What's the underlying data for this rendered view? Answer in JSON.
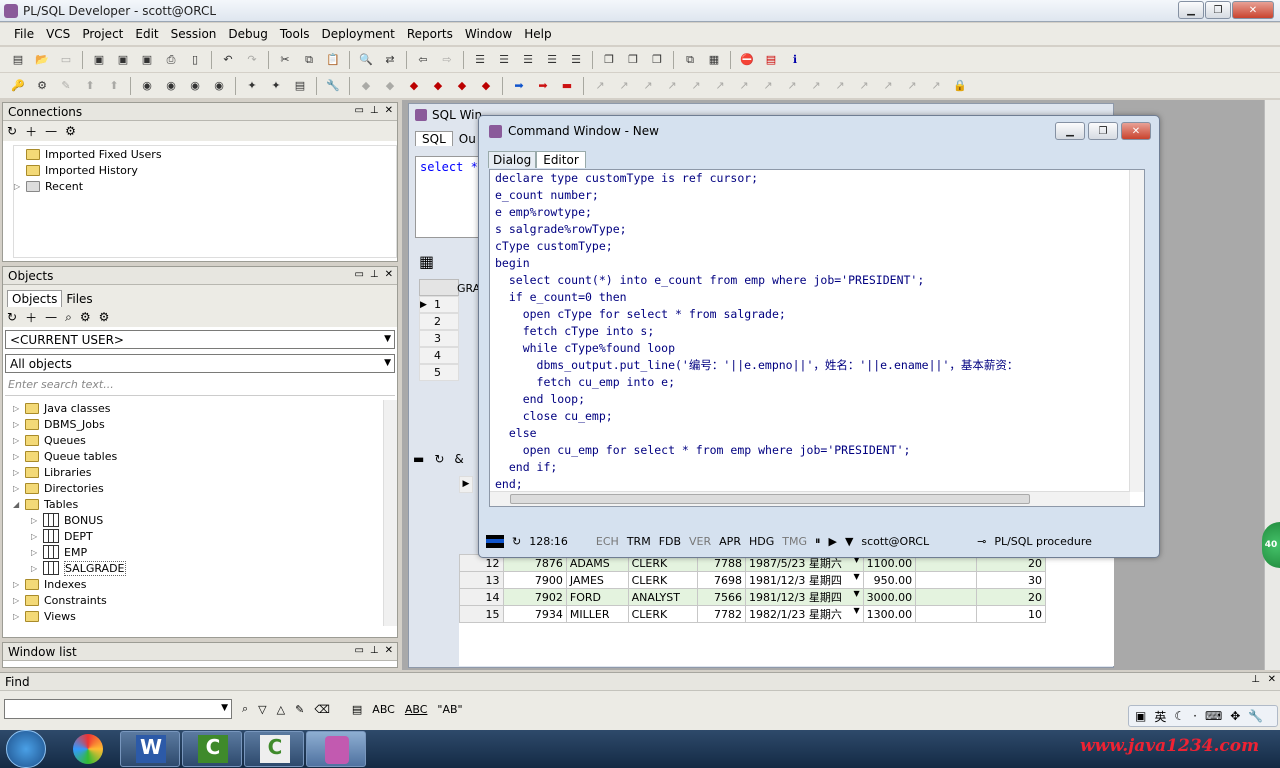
{
  "app": {
    "title": "PL/SQL Developer - scott@ORCL"
  },
  "menu": [
    "File",
    "VCS",
    "Project",
    "Edit",
    "Session",
    "Debug",
    "Tools",
    "Deployment",
    "Reports",
    "Window",
    "Help"
  ],
  "connections": {
    "title": "Connections",
    "items": [
      "Imported Fixed Users",
      "Imported History",
      "Recent"
    ]
  },
  "objects": {
    "title": "Objects",
    "tabs": [
      "Objects",
      "Files"
    ],
    "user_combo": "<CURRENT USER>",
    "filter_combo": "All objects",
    "search_placeholder": "Enter search text...",
    "tree": [
      "Java classes",
      "DBMS_Jobs",
      "Queues",
      "Queue tables",
      "Libraries",
      "Directories",
      "Tables",
      "BONUS",
      "DEPT",
      "EMP",
      "SALGRADE",
      "Indexes",
      "Constraints",
      "Views"
    ]
  },
  "window_list": {
    "title": "Window list"
  },
  "sql_window": {
    "title": "SQL Win",
    "tabs": [
      "SQL",
      "Ou"
    ],
    "sql_text": "select *",
    "grid_header": "GRA",
    "row_numbers": [
      "1",
      "2",
      "3",
      "4",
      "5"
    ],
    "toolbar_amp": "&"
  },
  "emp_rows": [
    {
      "n": "12",
      "empno": "7876",
      "ename": "ADAMS",
      "job": "CLERK",
      "mgr": "7788",
      "hiredate": "1987/5/23 星期六",
      "sal": "1100.00",
      "deptno": "20"
    },
    {
      "n": "13",
      "empno": "7900",
      "ename": "JAMES",
      "job": "CLERK",
      "mgr": "7698",
      "hiredate": "1981/12/3 星期四",
      "sal": "950.00",
      "deptno": "30"
    },
    {
      "n": "14",
      "empno": "7902",
      "ename": "FORD",
      "job": "ANALYST",
      "mgr": "7566",
      "hiredate": "1981/12/3 星期四",
      "sal": "3000.00",
      "deptno": "20"
    },
    {
      "n": "15",
      "empno": "7934",
      "ename": "MILLER",
      "job": "CLERK",
      "mgr": "7782",
      "hiredate": "1982/1/23 星期六",
      "sal": "1300.00",
      "deptno": "10"
    }
  ],
  "command_window": {
    "title": "Command Window - New",
    "tabs": [
      "Dialog",
      "Editor"
    ],
    "code": [
      "declare type customType is ref cursor;",
      "e_count number;",
      "e emp%rowtype;",
      "s salgrade%rowType;",
      "cType customType;",
      "begin",
      "  select count(*) into e_count from emp where job='PRESIDENT';",
      "  if e_count=0 then",
      "    open cType for select * from salgrade;",
      "    fetch cType into s;",
      "    while cType%found loop",
      "      dbms_output.put_line('编号：'||e.empno||'，姓名：'||e.ename||'，基本薪资：",
      "      fetch cu_emp into e;",
      "    end loop;",
      "    close cu_emp;",
      "  else",
      "    open cu_emp for select * from emp where job='PRESIDENT';",
      "  end if;",
      "end;"
    ],
    "status": {
      "position": "128:16",
      "flags": [
        "ECH",
        "TRM",
        "FDB",
        "VER",
        "APR",
        "HDG",
        "TMG"
      ],
      "connection": "scott@ORCL",
      "object": "PL/SQL procedure"
    }
  },
  "find": {
    "label": "Find",
    "abc": "ABC",
    "abc2": "ABC",
    "ab_quote": "\"AB\""
  },
  "ime": {
    "lang": "英"
  },
  "watermark": "www.java1234.com",
  "badge": "40"
}
